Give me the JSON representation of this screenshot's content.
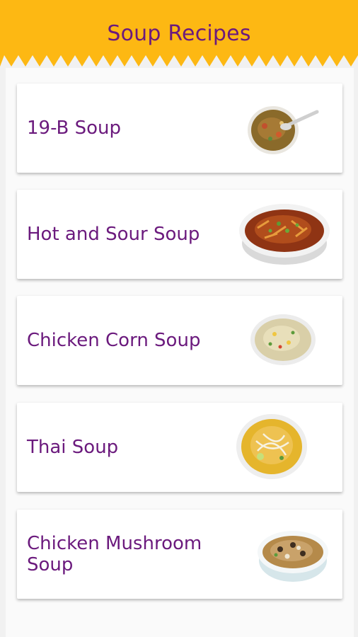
{
  "app": {
    "title": "Soup Recipes"
  },
  "colors": {
    "header_bg": "#fdb813",
    "title_text": "#6b1a7d",
    "card_bg": "#ffffff",
    "page_bg": "#fafafa"
  },
  "recipes": [
    {
      "label": "19-B Soup",
      "icon": "soup-bowl-spoon-icon"
    },
    {
      "label": "Hot and Sour Soup",
      "icon": "soup-bowl-icon"
    },
    {
      "label": "Chicken Corn Soup",
      "icon": "soup-bowl-icon"
    },
    {
      "label": "Thai Soup",
      "icon": "soup-bowl-icon"
    },
    {
      "label": "Chicken Mushroom Soup",
      "icon": "soup-bowl-icon"
    }
  ]
}
